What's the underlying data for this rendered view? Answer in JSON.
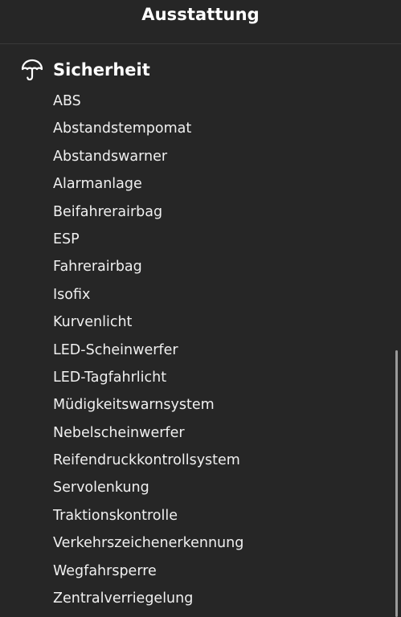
{
  "header": {
    "title": "Ausstattung"
  },
  "section": {
    "icon": "umbrella-icon",
    "title": "Sicherheit",
    "items": [
      "ABS",
      "Abstandstempomat",
      "Abstandswarner",
      "Alarmanlage",
      "Beifahrerairbag",
      "ESP",
      "Fahrerairbag",
      "Isofix",
      "Kurvenlicht",
      "LED-Scheinwerfer",
      "LED-Tagfahrlicht",
      "Müdigkeitswarnsystem",
      "Nebelscheinwerfer",
      "Reifendruckkontrollsystem",
      "Servolenkung",
      "Traktionskontrolle",
      "Verkehrszeichenerkennung",
      "Wegfahrsperre",
      "Zentralverriegelung"
    ]
  },
  "colors": {
    "background": "#262626",
    "text": "#ffffff",
    "scrollbar": "#9a9a9a"
  }
}
